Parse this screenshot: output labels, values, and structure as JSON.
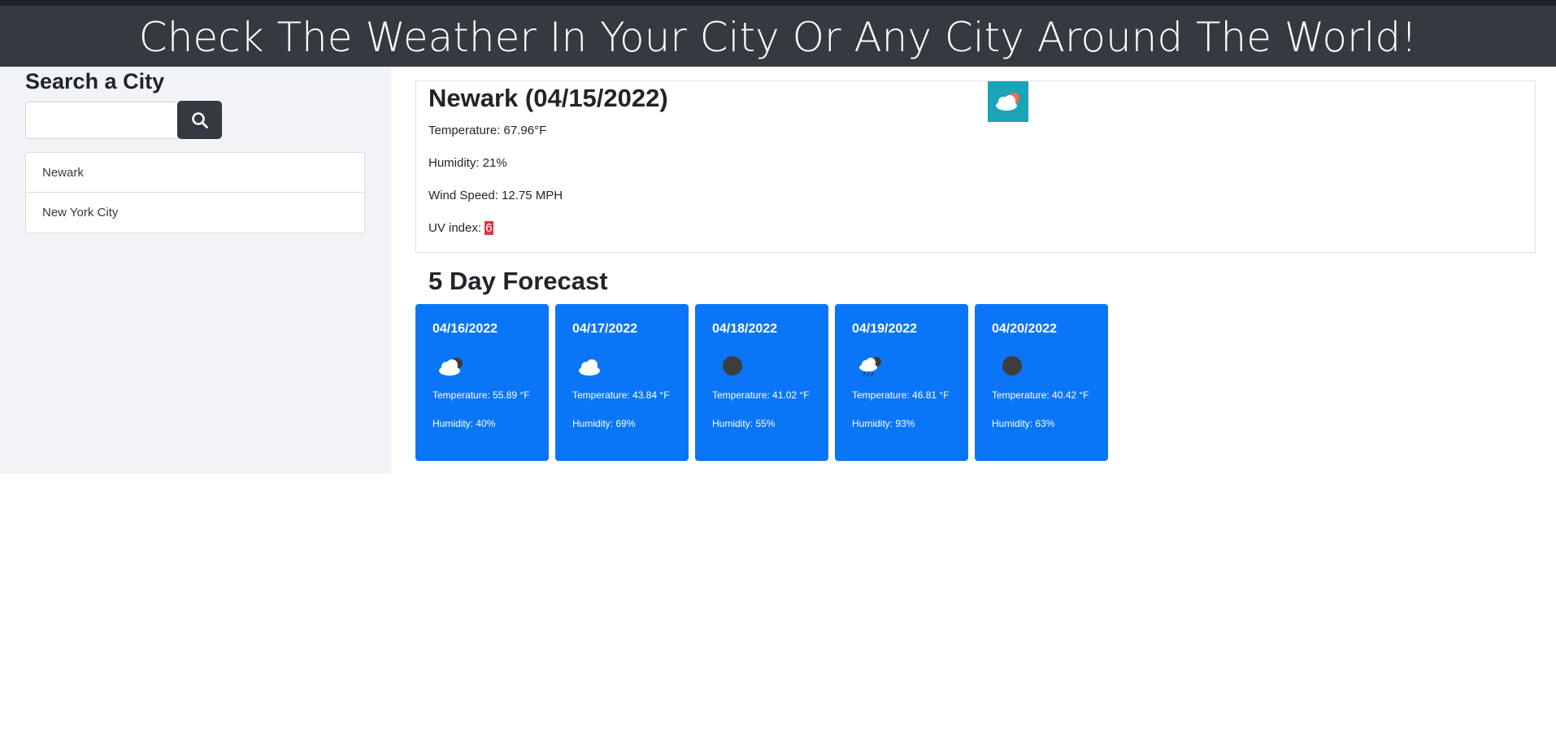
{
  "header": {
    "title": "Check The Weather In Your City Or Any City Around The World!"
  },
  "sidebar": {
    "heading": "Search a City",
    "search": {
      "value": "",
      "placeholder": "",
      "button_icon": "search-icon"
    },
    "history": [
      {
        "label": "Newark"
      },
      {
        "label": "New York City"
      }
    ]
  },
  "current": {
    "title": "Newark (04/15/2022)",
    "icon": "cloud-sun-icon",
    "temperature": "Temperature: 67.96°F",
    "humidity": "Humidity: 21%",
    "wind": "Wind Speed: 12.75 MPH",
    "uv_label": "UV index: ",
    "uv_value": "6",
    "uv_color": "#dc3545"
  },
  "forecast": {
    "title": "5 Day Forecast",
    "card_color": "#0a76f7",
    "days": [
      {
        "date": "04/16/2022",
        "icon": "cloud-icon",
        "temperature": "Temperature: 55.89 °F",
        "humidity": "Humidity: 40%"
      },
      {
        "date": "04/17/2022",
        "icon": "cloud-icon",
        "temperature": "Temperature: 43.84 °F",
        "humidity": "Humidity: 69%"
      },
      {
        "date": "04/18/2022",
        "icon": "moon-icon",
        "temperature": "Temperature: 41.02 °F",
        "humidity": "Humidity: 55%"
      },
      {
        "date": "04/19/2022",
        "icon": "rain-cloud-icon",
        "temperature": "Temperature: 46.81 °F",
        "humidity": "Humidity: 93%"
      },
      {
        "date": "04/20/2022",
        "icon": "moon-icon",
        "temperature": "Temperature: 40.42 °F",
        "humidity": "Humidity: 63%"
      }
    ]
  }
}
